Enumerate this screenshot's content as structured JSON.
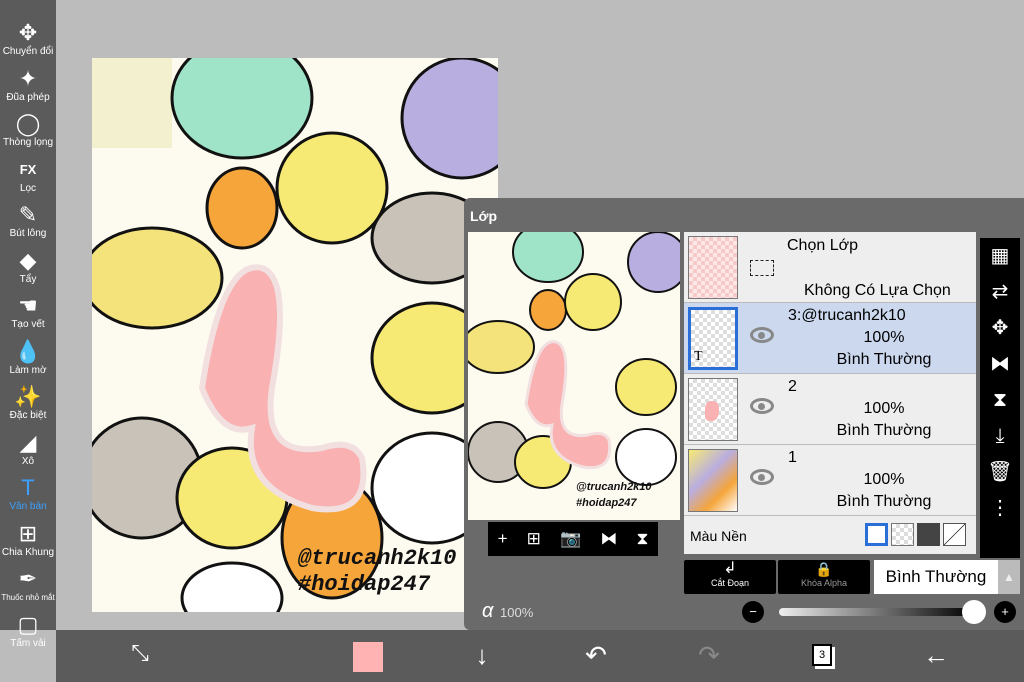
{
  "toolbar": {
    "items": [
      {
        "label": "Chuyển đổi",
        "icon": "move-icon",
        "glyph": "✥"
      },
      {
        "label": "Đũa phép",
        "icon": "magic-wand-icon",
        "glyph": "✦"
      },
      {
        "label": "Thòng lọng",
        "icon": "lasso-icon",
        "glyph": "◯"
      },
      {
        "label": "Lọc",
        "icon": "fx-icon",
        "glyph": "FX"
      },
      {
        "label": "Bút lông",
        "icon": "brush-icon",
        "glyph": "✎"
      },
      {
        "label": "Tẩy",
        "icon": "eraser-icon",
        "glyph": "◆"
      },
      {
        "label": "Tạo vết",
        "icon": "smudge-icon",
        "glyph": "☚"
      },
      {
        "label": "Làm mờ",
        "icon": "blur-icon",
        "glyph": "💧"
      },
      {
        "label": "Đặc biệt",
        "icon": "special-icon",
        "glyph": "✨"
      },
      {
        "label": "Xô",
        "icon": "bucket-icon",
        "glyph": "◢"
      },
      {
        "label": "Văn bản",
        "icon": "text-icon",
        "glyph": "T"
      },
      {
        "label": "Chia Khung",
        "icon": "frame-divider-icon",
        "glyph": "⊞"
      },
      {
        "label": "Thuốc nhỏ mắt",
        "icon": "eyedropper-icon",
        "glyph": "✒"
      },
      {
        "label": "Tấm vải",
        "icon": "canvas-icon",
        "glyph": "▢"
      }
    ]
  },
  "artwork": {
    "line1": "@trucanh2k10",
    "line2": "#hoidap247"
  },
  "panel": {
    "title": "Lớp",
    "selection": {
      "title": "Chọn Lớp",
      "status": "Không Có Lựa Chọn"
    },
    "layers": [
      {
        "name": "3:@trucanh2k10",
        "opacity": "100%",
        "mode": "Bình Thường",
        "selected": true,
        "thumb_text": "T"
      },
      {
        "name": "2",
        "opacity": "100%",
        "mode": "Bình Thường",
        "selected": false
      },
      {
        "name": "1",
        "opacity": "100%",
        "mode": "Bình Thường",
        "selected": false
      }
    ],
    "background_label": "Màu Nền",
    "clip_label": "Cắt Đoạn",
    "alpha_lock_label": "Khóa Alpha",
    "blend_mode": "Bình Thường",
    "alpha_symbol": "α",
    "alpha_value": "100%",
    "alpha_fraction": 1.0
  },
  "bottom": {
    "layer_count": "3",
    "color": "#ffb3b3"
  }
}
